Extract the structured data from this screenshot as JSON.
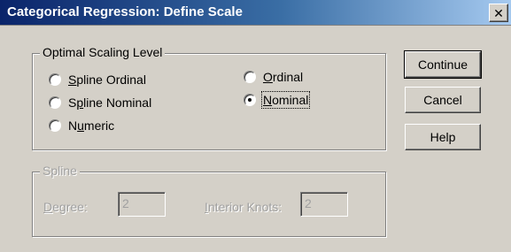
{
  "window": {
    "title": "Categorical Regression: Define Scale",
    "close_glyph": "✕"
  },
  "scaling_group": {
    "legend": "Optimal Scaling Level",
    "options": [
      {
        "label": "Spline Ordinal",
        "mnemonic": "S",
        "selected": false
      },
      {
        "label": "Spline Nominal",
        "mnemonic": "p",
        "selected": false
      },
      {
        "label": "Numeric",
        "mnemonic": "u",
        "selected": false
      },
      {
        "label": "Ordinal",
        "mnemonic": "O",
        "selected": false
      },
      {
        "label": "Nominal",
        "mnemonic": "N",
        "selected": true
      }
    ]
  },
  "buttons": {
    "continue": "Continue",
    "cancel": "Cancel",
    "help": "Help"
  },
  "spline_group": {
    "legend": "Spline",
    "degree_label": "Degree:",
    "degree_value": "2",
    "knots_label": "Interior Knots:",
    "knots_value": "2",
    "enabled": false
  }
}
